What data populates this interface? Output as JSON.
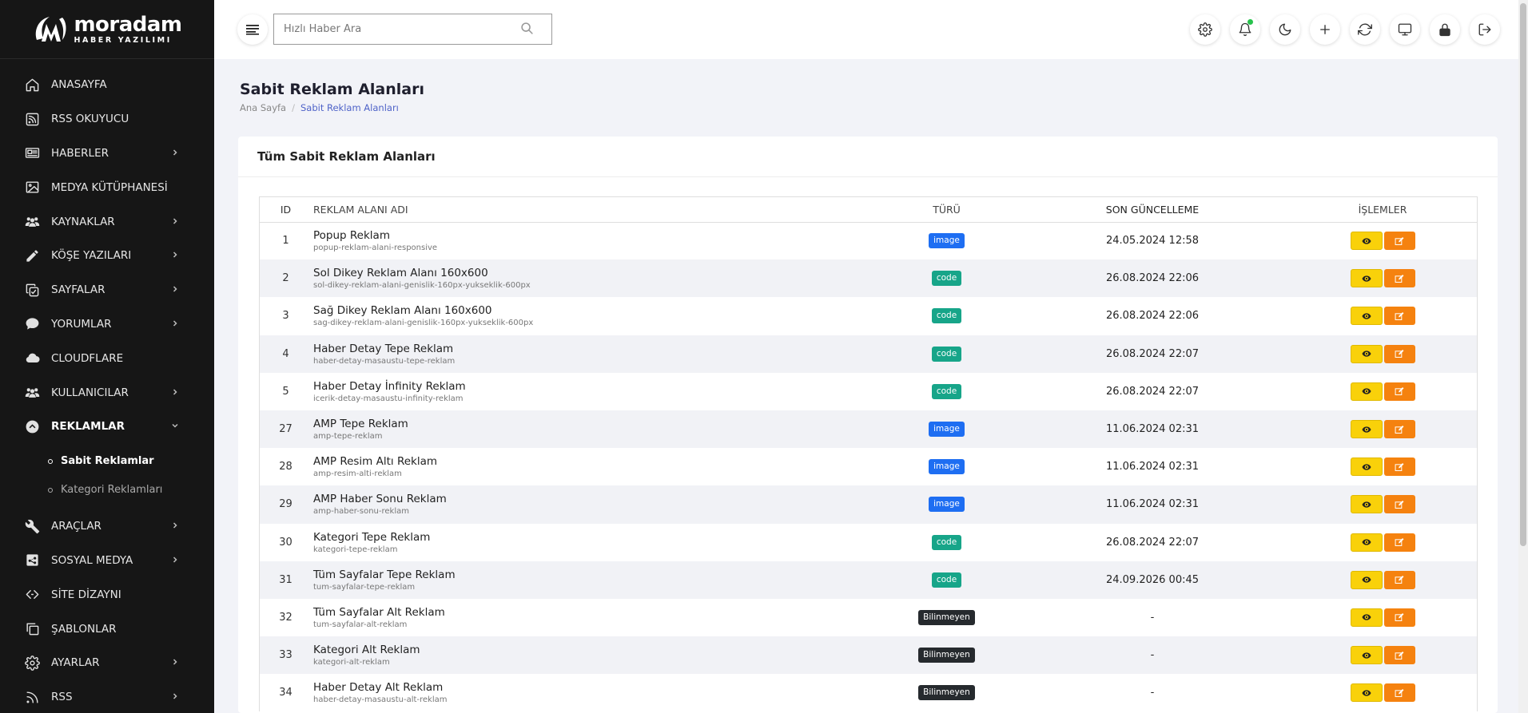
{
  "brand": {
    "name": "moradam",
    "subtitle": "HABER YAZILIMI"
  },
  "sidebar": {
    "items": [
      {
        "label": "ANASAYFA",
        "icon": "home-icon",
        "chevron": false
      },
      {
        "label": "RSS OKUYUCU",
        "icon": "rss-square-icon",
        "chevron": false
      },
      {
        "label": "HABERLER",
        "icon": "newspaper-icon",
        "chevron": true
      },
      {
        "label": "MEDYA KÜTÜPHANESİ",
        "icon": "image-icon",
        "chevron": false
      },
      {
        "label": "KAYNAKLAR",
        "icon": "users-icon",
        "chevron": true
      },
      {
        "label": "KÖŞE YAZILARI",
        "icon": "pencil-icon",
        "chevron": true
      },
      {
        "label": "SAYFALAR",
        "icon": "copy-icon",
        "chevron": true
      },
      {
        "label": "YORUMLAR",
        "icon": "comment-icon",
        "chevron": true
      },
      {
        "label": "CLOUDFLARE",
        "icon": "cloud-icon",
        "chevron": false
      },
      {
        "label": "KULLANICILAR",
        "icon": "users-icon",
        "chevron": true
      },
      {
        "label": "REKLAMLAR",
        "icon": "arrow-up-circle-icon",
        "chevron": true,
        "expanded": true
      },
      {
        "label": "ARAÇLAR",
        "icon": "wrench-icon",
        "chevron": true
      },
      {
        "label": "SOSYAL MEDYA",
        "icon": "share-icon",
        "chevron": true
      },
      {
        "label": "SİTE DİZAYNI",
        "icon": "code-icon",
        "chevron": false
      },
      {
        "label": "ŞABLONLAR",
        "icon": "clone-icon",
        "chevron": false
      },
      {
        "label": "AYARLAR",
        "icon": "gear-icon",
        "chevron": true
      },
      {
        "label": "RSS",
        "icon": "rss-icon",
        "chevron": true
      }
    ],
    "subitems": [
      {
        "label": "Sabit Reklamlar",
        "active": true
      },
      {
        "label": "Kategori Reklamları",
        "active": false
      }
    ]
  },
  "topbar": {
    "search_placeholder": "Hızlı Haber Ara",
    "icons": [
      "settings-icon",
      "bell-icon",
      "moon-icon",
      "plus-icon",
      "refresh-icon",
      "monitor-icon",
      "lock-icon",
      "logout-icon"
    ]
  },
  "page": {
    "title": "Sabit Reklam Alanları",
    "breadcrumb": {
      "home": "Ana Sayfa",
      "current": "Sabit Reklam Alanları"
    }
  },
  "card": {
    "title": "Tüm Sabit Reklam Alanları"
  },
  "table": {
    "headers": {
      "id": "ID",
      "name": "REKLAM ALANI ADI",
      "type": "TÜRÜ",
      "updated": "SON GÜNCELLEME",
      "actions": "İŞLEMLER"
    },
    "rows": [
      {
        "id": "1",
        "name": "Popup Reklam",
        "slug": "popup-reklam-alani-responsive",
        "type": "image",
        "updated": "24.05.2024 12:58"
      },
      {
        "id": "2",
        "name": "Sol Dikey Reklam Alanı 160x600",
        "slug": "sol-dikey-reklam-alani-genislik-160px-yukseklik-600px",
        "type": "code",
        "updated": "26.08.2024 22:06"
      },
      {
        "id": "3",
        "name": "Sağ Dikey Reklam Alanı 160x600",
        "slug": "sag-dikey-reklam-alani-genislik-160px-yukseklik-600px",
        "type": "code",
        "updated": "26.08.2024 22:06"
      },
      {
        "id": "4",
        "name": "Haber Detay Tepe Reklam",
        "slug": "haber-detay-masaustu-tepe-reklam",
        "type": "code",
        "updated": "26.08.2024 22:07"
      },
      {
        "id": "5",
        "name": "Haber Detay İnfinity Reklam",
        "slug": "icerik-detay-masaustu-infinity-reklam",
        "type": "code",
        "updated": "26.08.2024 22:07"
      },
      {
        "id": "27",
        "name": "AMP Tepe Reklam",
        "slug": "amp-tepe-reklam",
        "type": "image",
        "updated": "11.06.2024 02:31"
      },
      {
        "id": "28",
        "name": "AMP Resim Altı Reklam",
        "slug": "amp-resim-alti-reklam",
        "type": "image",
        "updated": "11.06.2024 02:31"
      },
      {
        "id": "29",
        "name": "AMP Haber Sonu Reklam",
        "slug": "amp-haber-sonu-reklam",
        "type": "image",
        "updated": "11.06.2024 02:31"
      },
      {
        "id": "30",
        "name": "Kategori Tepe Reklam",
        "slug": "kategori-tepe-reklam",
        "type": "code",
        "updated": "26.08.2024 22:07"
      },
      {
        "id": "31",
        "name": "Tüm Sayfalar Tepe Reklam",
        "slug": "tum-sayfalar-tepe-reklam",
        "type": "code",
        "updated": "24.09.2026 00:45"
      },
      {
        "id": "32",
        "name": "Tüm Sayfalar Alt Reklam",
        "slug": "tum-sayfalar-alt-reklam",
        "type": "Bilinmeyen",
        "updated": "-"
      },
      {
        "id": "33",
        "name": "Kategori Alt Reklam",
        "slug": "kategori-alt-reklam",
        "type": "Bilinmeyen",
        "updated": "-"
      },
      {
        "id": "34",
        "name": "Haber Detay Alt Reklam",
        "slug": "haber-detay-masaustu-alt-reklam",
        "type": "Bilinmeyen",
        "updated": "-"
      }
    ]
  },
  "colors": {
    "image": "#1e6ef2",
    "code": "#17a589",
    "unknown": "#262a2e",
    "view_button": "#f9d10a",
    "edit_button": "#f5820f",
    "breadcrumb_active": "#4f63c8"
  }
}
